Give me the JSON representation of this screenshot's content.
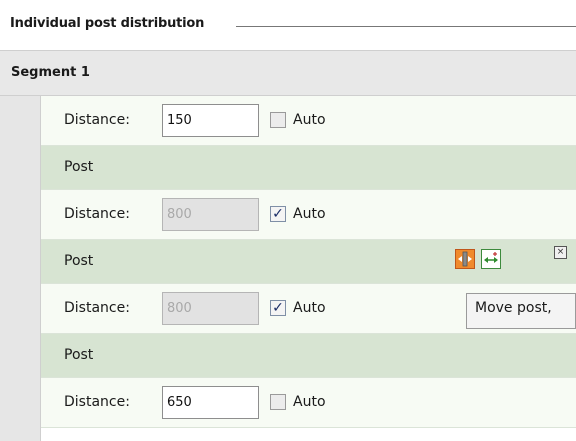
{
  "section": {
    "title": "Individual post distribution"
  },
  "segment": {
    "title": "Segment 1"
  },
  "rows": [
    {
      "type": "distance",
      "label": "Distance:",
      "value": "150",
      "disabled": false,
      "auto_label": "Auto",
      "auto_checked": false
    },
    {
      "type": "post",
      "label": "Post"
    },
    {
      "type": "distance",
      "label": "Distance:",
      "value": "800",
      "disabled": true,
      "auto_label": "Auto",
      "auto_checked": true
    },
    {
      "type": "post",
      "label": "Post",
      "active": true
    },
    {
      "type": "distance",
      "label": "Distance:",
      "value": "800",
      "disabled": true,
      "auto_label": "Auto",
      "auto_checked": true
    },
    {
      "type": "post",
      "label": "Post"
    },
    {
      "type": "distance",
      "label": "Distance:",
      "value": "650",
      "disabled": false,
      "auto_label": "Auto",
      "auto_checked": false
    }
  ],
  "tooltip": {
    "text": "Move post,"
  },
  "check_mark": "✓",
  "close_glyph": "×",
  "icons": {
    "move": "move-post-icon",
    "swap": "swap-arrows-icon",
    "close": "close-icon"
  },
  "colors": {
    "distance_row_bg": "#f7fbf4",
    "post_row_bg": "#d7e4d2",
    "segment_header_bg": "#e8e8e8",
    "move_button": "#f08a2c",
    "swap_arrow": "#2e8b2e"
  }
}
